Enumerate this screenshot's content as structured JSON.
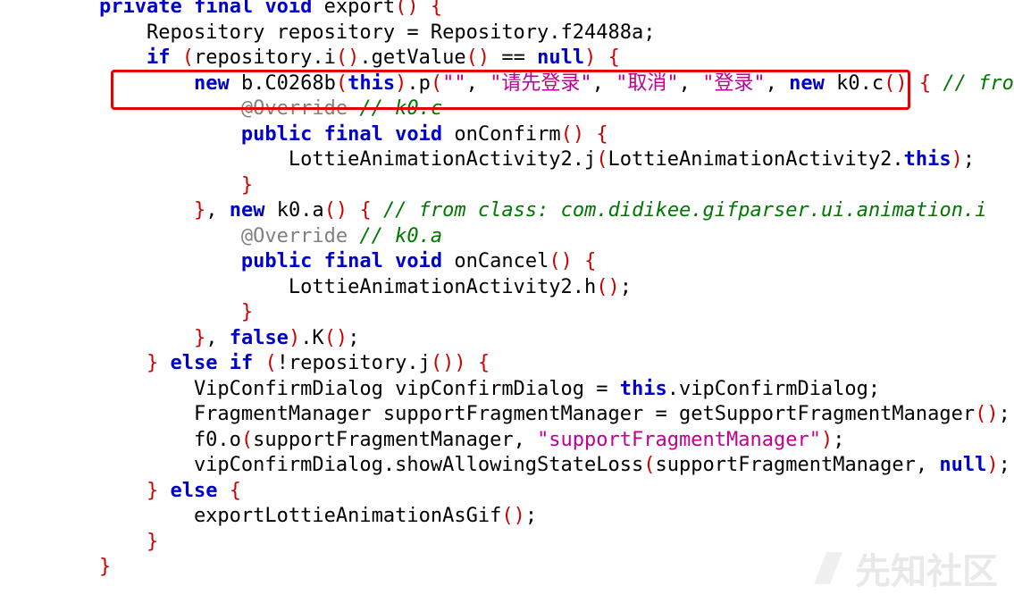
{
  "editor": {
    "lines": [
      [
        [
          "    ",
          "pl"
        ],
        [
          "private",
          "kw"
        ],
        [
          " ",
          "pl"
        ],
        [
          "final",
          "kw"
        ],
        [
          " ",
          "pl"
        ],
        [
          "void",
          "kw"
        ],
        [
          " export",
          "pl"
        ],
        [
          "()",
          "pn"
        ],
        [
          " ",
          "pl"
        ],
        [
          "{",
          "pn"
        ]
      ],
      [
        [
          "        Repository repository = Repository.f24488a;",
          "pl"
        ]
      ],
      [
        [
          "        ",
          "pl"
        ],
        [
          "if",
          "kw"
        ],
        [
          " ",
          "pl"
        ],
        [
          "(",
          "pn"
        ],
        [
          "repository.i",
          "pl"
        ],
        [
          "()",
          "pn"
        ],
        [
          ".getValue",
          "pl"
        ],
        [
          "()",
          "pn"
        ],
        [
          " == ",
          "pl"
        ],
        [
          "null",
          "kw"
        ],
        [
          ")",
          "pn"
        ],
        [
          " ",
          "pl"
        ],
        [
          "{",
          "pn"
        ]
      ],
      [
        [
          "            ",
          "pl"
        ],
        [
          "new",
          "kw"
        ],
        [
          " b.C0268b",
          "pl"
        ],
        [
          "(",
          "pn"
        ],
        [
          "this",
          "kw"
        ],
        [
          ")",
          "pn"
        ],
        [
          ".p",
          "pl"
        ],
        [
          "(",
          "pn"
        ],
        [
          "\"\"",
          "str"
        ],
        [
          ", ",
          "pl"
        ],
        [
          "\"请先登录\"",
          "str"
        ],
        [
          ", ",
          "pl"
        ],
        [
          "\"取消\"",
          "str"
        ],
        [
          ", ",
          "pl"
        ],
        [
          "\"登录\"",
          "str"
        ],
        [
          ", ",
          "pl"
        ],
        [
          "new",
          "kw"
        ],
        [
          " k0.c",
          "pl"
        ],
        [
          "()",
          "pn"
        ],
        [
          " ",
          "pl"
        ],
        [
          "{",
          "pn"
        ],
        [
          " ",
          "pl"
        ],
        [
          "// from c",
          "cm"
        ]
      ],
      [
        [
          "                ",
          "pl"
        ],
        [
          "@Override",
          "an"
        ],
        [
          " ",
          "pl"
        ],
        [
          "// k0.c",
          "cm"
        ]
      ],
      [
        [
          "                ",
          "pl"
        ],
        [
          "public",
          "kw"
        ],
        [
          " ",
          "pl"
        ],
        [
          "final",
          "kw"
        ],
        [
          " ",
          "pl"
        ],
        [
          "void",
          "kw"
        ],
        [
          " onConfirm",
          "pl"
        ],
        [
          "()",
          "pn"
        ],
        [
          " ",
          "pl"
        ],
        [
          "{",
          "pn"
        ]
      ],
      [
        [
          "                    LottieAnimationActivity2.j",
          "pl"
        ],
        [
          "(",
          "pn"
        ],
        [
          "LottieAnimationActivity2.",
          "pl"
        ],
        [
          "this",
          "kw"
        ],
        [
          ")",
          "pn"
        ],
        [
          ";",
          "pl"
        ]
      ],
      [
        [
          "                ",
          "pl"
        ],
        [
          "}",
          "pn"
        ]
      ],
      [
        [
          "            ",
          "pl"
        ],
        [
          "}",
          "pn"
        ],
        [
          ", ",
          "pl"
        ],
        [
          "new",
          "kw"
        ],
        [
          " k0.a",
          "pl"
        ],
        [
          "()",
          "pn"
        ],
        [
          " ",
          "pl"
        ],
        [
          "{",
          "pn"
        ],
        [
          " ",
          "pl"
        ],
        [
          "// from class: com.didikee.gifparser.ui.animation.i",
          "cm"
        ]
      ],
      [
        [
          "                ",
          "pl"
        ],
        [
          "@Override",
          "an"
        ],
        [
          " ",
          "pl"
        ],
        [
          "// k0.a",
          "cm"
        ]
      ],
      [
        [
          "                ",
          "pl"
        ],
        [
          "public",
          "kw"
        ],
        [
          " ",
          "pl"
        ],
        [
          "final",
          "kw"
        ],
        [
          " ",
          "pl"
        ],
        [
          "void",
          "kw"
        ],
        [
          " onCancel",
          "pl"
        ],
        [
          "()",
          "pn"
        ],
        [
          " ",
          "pl"
        ],
        [
          "{",
          "pn"
        ]
      ],
      [
        [
          "                    LottieAnimationActivity2.h",
          "pl"
        ],
        [
          "()",
          "pn"
        ],
        [
          ";",
          "pl"
        ]
      ],
      [
        [
          "                ",
          "pl"
        ],
        [
          "}",
          "pn"
        ]
      ],
      [
        [
          "            ",
          "pl"
        ],
        [
          "}",
          "pn"
        ],
        [
          ", ",
          "pl"
        ],
        [
          "false",
          "kw"
        ],
        [
          ")",
          "pn"
        ],
        [
          ".K",
          "pl"
        ],
        [
          "()",
          "pn"
        ],
        [
          ";",
          "pl"
        ]
      ],
      [
        [
          "        ",
          "pl"
        ],
        [
          "}",
          "pn"
        ],
        [
          " ",
          "pl"
        ],
        [
          "else",
          "kw"
        ],
        [
          " ",
          "pl"
        ],
        [
          "if",
          "kw"
        ],
        [
          " ",
          "pl"
        ],
        [
          "(",
          "pn"
        ],
        [
          "!repository.j",
          "pl"
        ],
        [
          "())",
          "pn"
        ],
        [
          " ",
          "pl"
        ],
        [
          "{",
          "pn"
        ]
      ],
      [
        [
          "            VipConfirmDialog vipConfirmDialog = ",
          "pl"
        ],
        [
          "this",
          "kw"
        ],
        [
          ".vipConfirmDialog;",
          "pl"
        ]
      ],
      [
        [
          "            FragmentManager supportFragmentManager = getSupportFragmentManager",
          "pl"
        ],
        [
          "()",
          "pn"
        ],
        [
          ";",
          "pl"
        ]
      ],
      [
        [
          "            f0.o",
          "pl"
        ],
        [
          "(",
          "pn"
        ],
        [
          "supportFragmentManager, ",
          "pl"
        ],
        [
          "\"supportFragmentManager\"",
          "str"
        ],
        [
          ")",
          "pn"
        ],
        [
          ";",
          "pl"
        ]
      ],
      [
        [
          "            vipConfirmDialog.showAllowingStateLoss",
          "pl"
        ],
        [
          "(",
          "pn"
        ],
        [
          "supportFragmentManager, ",
          "pl"
        ],
        [
          "null",
          "kw"
        ],
        [
          ")",
          "pn"
        ],
        [
          ";",
          "pl"
        ]
      ],
      [
        [
          "        ",
          "pl"
        ],
        [
          "}",
          "pn"
        ],
        [
          " ",
          "pl"
        ],
        [
          "else",
          "kw"
        ],
        [
          " ",
          "pl"
        ],
        [
          "{",
          "pn"
        ]
      ],
      [
        [
          "            exportLottieAnimationAsGif",
          "pl"
        ],
        [
          "()",
          "pn"
        ],
        [
          ";",
          "pl"
        ]
      ],
      [
        [
          "        ",
          "pl"
        ],
        [
          "}",
          "pn"
        ]
      ],
      [
        [
          "    ",
          "pl"
        ],
        [
          "}",
          "pn"
        ]
      ]
    ]
  },
  "watermark": {
    "text": "先知社区"
  },
  "colors": {
    "keyword": "#0000cc",
    "string": "#c00090",
    "comment": "#007700",
    "annotation": "#808080",
    "paren": "#cc0000",
    "highlight_box": "#e60000"
  }
}
